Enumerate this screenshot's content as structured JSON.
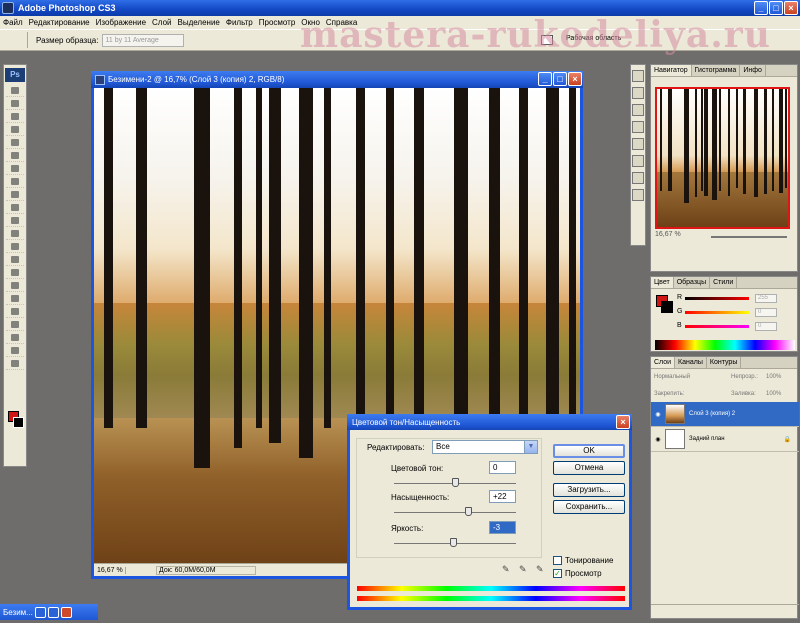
{
  "app": {
    "title": "Adobe Photoshop CS3",
    "watermark": "mastera-rukodeliya.ru"
  },
  "menu": [
    "Файл",
    "Редактирование",
    "Изображение",
    "Слой",
    "Выделение",
    "Фильтр",
    "Просмотр",
    "Окно",
    "Справка"
  ],
  "options_bar": {
    "sample_size_label": "Размер образца:",
    "sample_size_value": "11 by 11 Average",
    "workspace_label": "Рабочая область"
  },
  "document": {
    "title": "Безимени-2 @ 16,7% (Слой 3 (копия) 2, RGB/8)",
    "zoom": "16,67 %",
    "doc_info": "Док: 60,0M/60,0M"
  },
  "navigator": {
    "tabs": [
      "Навигатор",
      "Гистограмма",
      "Инфо"
    ],
    "zoom": "16,67 %"
  },
  "color_panel": {
    "tabs": [
      "Цвет",
      "Образцы",
      "Стили"
    ],
    "channels": [
      {
        "label": "R",
        "value": "255"
      },
      {
        "label": "G",
        "value": "0"
      },
      {
        "label": "B",
        "value": "0"
      }
    ]
  },
  "layers_panel": {
    "tabs": [
      "Слои",
      "Каналы",
      "Контуры"
    ],
    "blend_mode": "Нормальный",
    "opacity_label": "Непрозр.:",
    "opacity_value": "100%",
    "lock_label": "Закрепить:",
    "fill_label": "Заливка:",
    "fill_value": "100%",
    "layers": [
      {
        "name": "Слой 3 (копия) 2",
        "selected": true
      },
      {
        "name": "Задний план",
        "selected": false
      }
    ]
  },
  "dialog": {
    "title": "Цветовой тон/Насыщенность",
    "edit_label": "Редактировать:",
    "edit_value": "Все",
    "hue_label": "Цветовой тон:",
    "hue_value": "0",
    "saturation_label": "Насыщенность:",
    "saturation_value": "+22",
    "lightness_label": "Яркость:",
    "lightness_value": "-3",
    "ok": "OK",
    "cancel": "Отмена",
    "load": "Загрузить...",
    "save": "Сохранить...",
    "colorize_label": "Тонирование",
    "colorize_checked": false,
    "preview_label": "Просмотр",
    "preview_checked": true,
    "hue_level": 0.5,
    "saturation_level": 0.61,
    "lightness_level": 0.485
  },
  "taskbar": {
    "item": "Безим..."
  }
}
